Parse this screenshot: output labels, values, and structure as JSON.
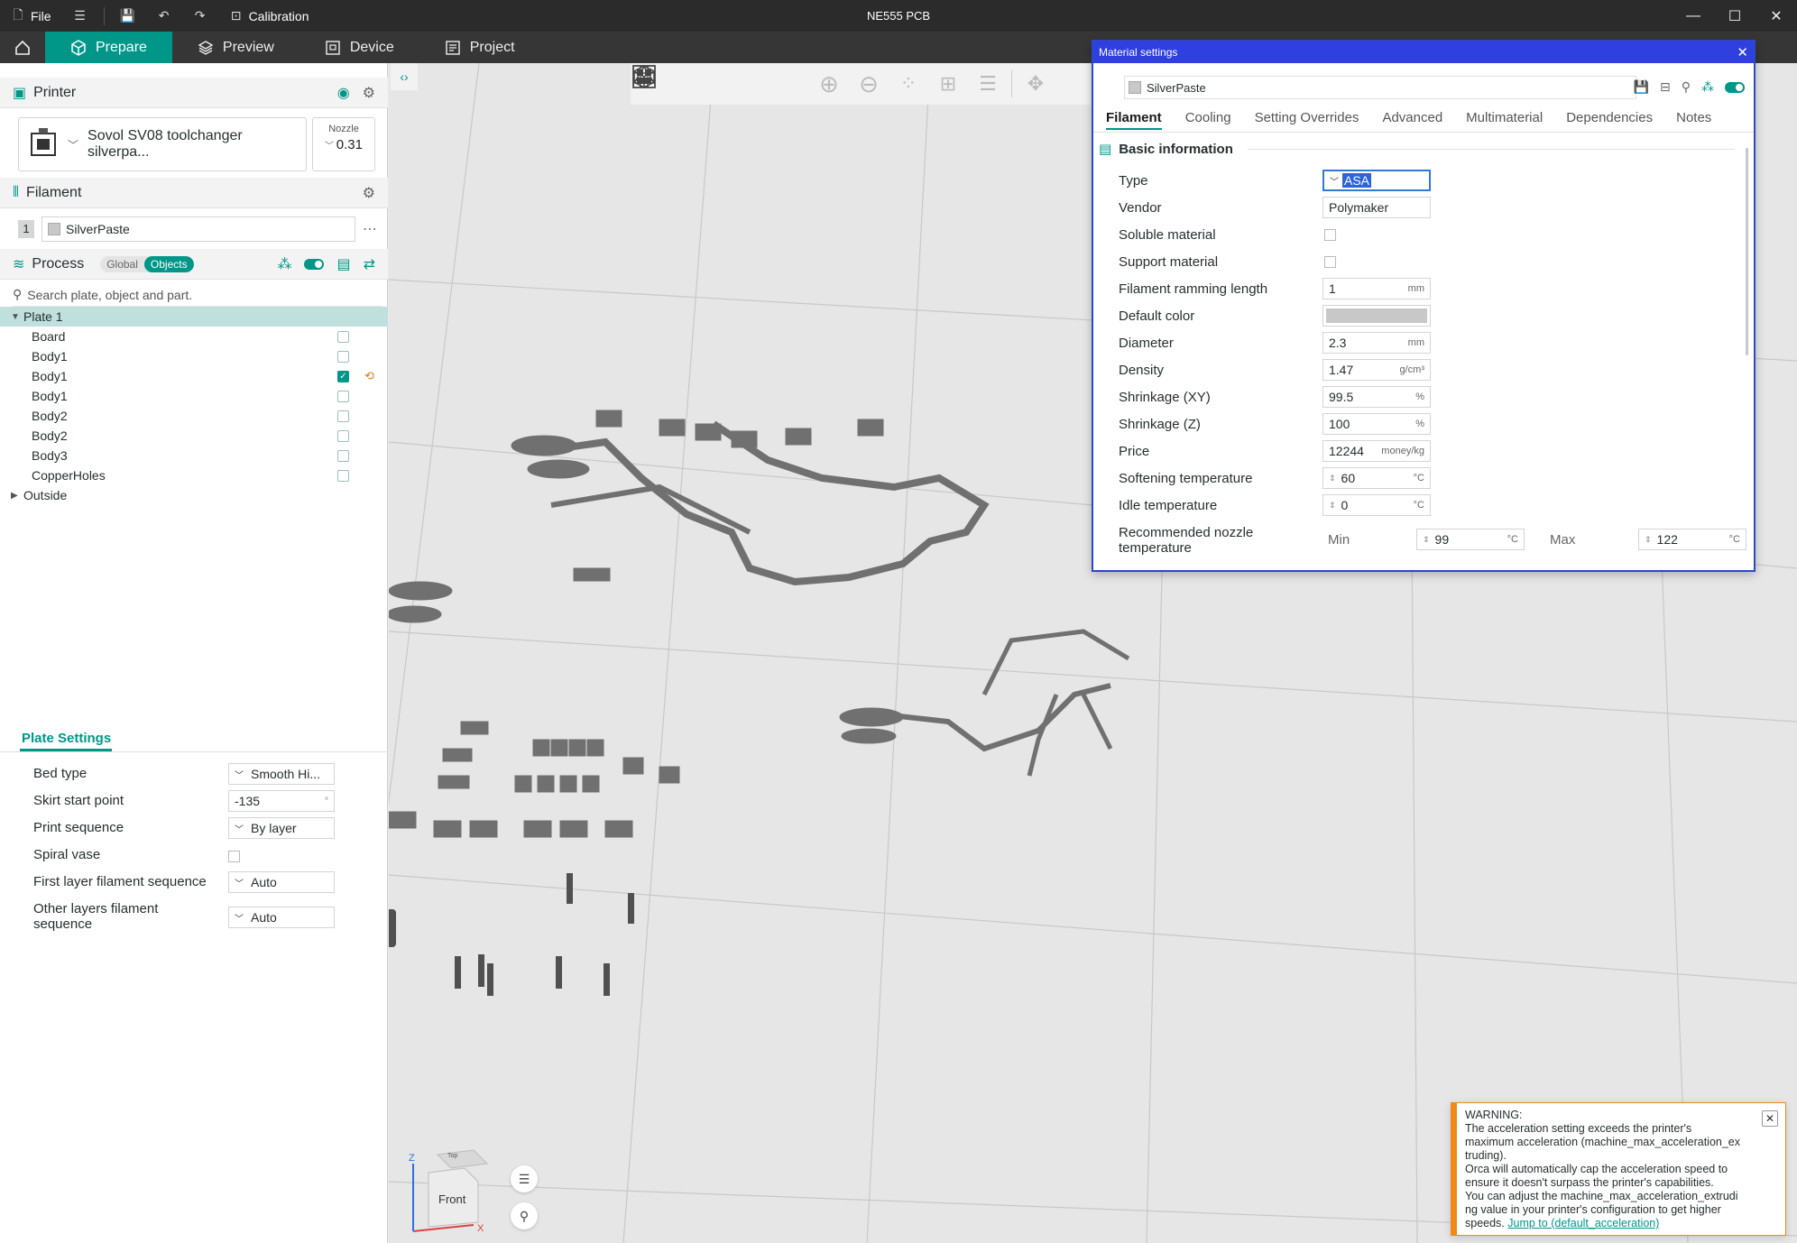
{
  "titlebar": {
    "file_label": "File",
    "calibration_label": "Calibration",
    "project_title": "NE555 PCB"
  },
  "tabs": {
    "prepare": "Prepare",
    "preview": "Preview",
    "device": "Device",
    "project": "Project"
  },
  "printer": {
    "section_title": "Printer",
    "name": "Sovol SV08 toolchanger silverpa...",
    "nozzle_label": "Nozzle",
    "nozzle_value": "0.31"
  },
  "filament": {
    "section_title": "Filament",
    "slot": "1",
    "name": "SilverPaste"
  },
  "process": {
    "section_title": "Process",
    "mode_global": "Global",
    "mode_objects": "Objects",
    "search_placeholder": "Search plate, object and part."
  },
  "tree": {
    "plate": "Plate 1",
    "objects": [
      {
        "label": "Board",
        "checked": false
      },
      {
        "label": "Body1",
        "checked": false
      },
      {
        "label": "Body1",
        "checked": true
      },
      {
        "label": "Body1",
        "checked": false
      },
      {
        "label": "Body2",
        "checked": false
      },
      {
        "label": "Body2",
        "checked": false
      },
      {
        "label": "Body3",
        "checked": false
      },
      {
        "label": "CopperHoles",
        "checked": false
      }
    ],
    "outside": "Outside"
  },
  "plate_settings": {
    "title": "Plate Settings",
    "bed_type_label": "Bed type",
    "bed_type_value": "Smooth Hi...",
    "skirt_label": "Skirt start point",
    "skirt_value": "-135",
    "skirt_unit": "°",
    "print_seq_label": "Print sequence",
    "print_seq_value": "By layer",
    "spiral_label": "Spiral vase",
    "first_layer_label": "First layer filament sequence",
    "first_layer_value": "Auto",
    "other_layers_label_1": "Other layers filament",
    "other_layers_label_2": "sequence",
    "other_layers_value": "Auto"
  },
  "dialog": {
    "title": "Material settings",
    "preset_name": "SilverPaste",
    "tabs": [
      "Filament",
      "Cooling",
      "Setting Overrides",
      "Advanced",
      "Multimaterial",
      "Dependencies",
      "Notes"
    ],
    "section": "Basic information",
    "fields": {
      "type_label": "Type",
      "type_value": "ASA",
      "vendor_label": "Vendor",
      "vendor_value": "Polymaker",
      "soluble_label": "Soluble material",
      "support_label": "Support material",
      "ramming_label": "Filament ramming length",
      "ramming_value": "1",
      "ramming_unit": "mm",
      "color_label": "Default color",
      "color_value": "#c8c8c8",
      "diameter_label": "Diameter",
      "diameter_value": "2.3",
      "diameter_unit": "mm",
      "density_label": "Density",
      "density_value": "1.47",
      "density_unit": "g/cm³",
      "shrink_xy_label": "Shrinkage (XY)",
      "shrink_xy_value": "99.5",
      "shrink_xy_unit": "%",
      "shrink_z_label": "Shrinkage (Z)",
      "shrink_z_value": "100",
      "shrink_z_unit": "%",
      "price_label": "Price",
      "price_value": "12244",
      "price_unit": "money/kg",
      "soften_label": "Softening temperature",
      "soften_value": "60",
      "soften_unit": "°C",
      "idle_label": "Idle temperature",
      "idle_value": "0",
      "idle_unit": "°C",
      "nozzle_temp_label_1": "Recommended nozzle",
      "nozzle_temp_label_2": "temperature",
      "min_label": "Min",
      "min_value": "99",
      "min_unit": "°C",
      "max_label": "Max",
      "max_value": "122",
      "max_unit": "°C"
    }
  },
  "warning": {
    "title": "WARNING:",
    "line1": "The acceleration setting exceeds the printer's",
    "line2": "maximum acceleration (machine_max_acceleration_ex",
    "line3": "truding).",
    "line4": "Orca will automatically cap the acceleration speed to",
    "line5": "ensure it doesn't surpass the printer's capabilities.",
    "line6": "You can adjust the machine_max_acceleration_extrudi",
    "line7": "ng value in your printer's configuration to get higher",
    "line8": "speeds.",
    "link": "Jump to (default_acceleration)"
  },
  "navcube": {
    "face": "Front",
    "top_face": "Top",
    "axis_z": "Z",
    "axis_x": "X"
  },
  "colors": {
    "accent": "#009688",
    "dialog_title": "#2f3fe0",
    "warning": "#f08a17"
  }
}
